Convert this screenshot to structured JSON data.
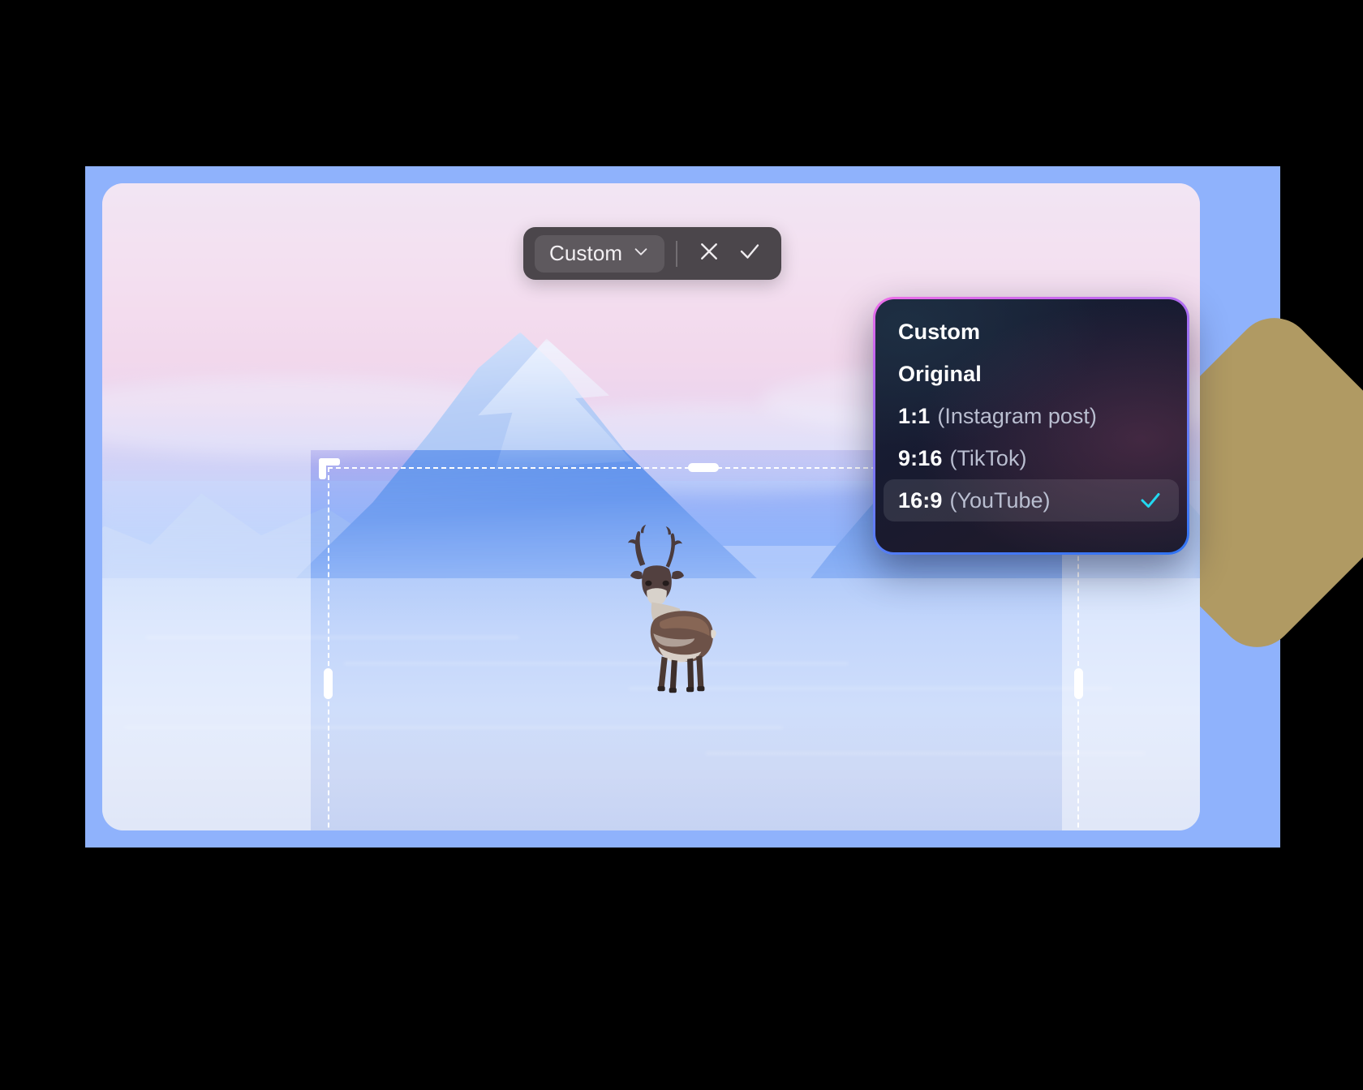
{
  "app": {
    "tool": "image-crop-editor"
  },
  "toolbar": {
    "ratio_label": "Custom",
    "chevron_icon": "chevron-down-icon",
    "cancel_icon": "close-icon",
    "confirm_icon": "check-icon"
  },
  "dropdown": {
    "items": [
      {
        "main": "Custom",
        "sub": "",
        "selected": false
      },
      {
        "main": "Original",
        "sub": "",
        "selected": false
      },
      {
        "main": "1:1",
        "sub": "(Instagram post)",
        "selected": false
      },
      {
        "main": "9:16",
        "sub": "(TikTok)",
        "selected": false
      },
      {
        "main": "16:9",
        "sub": "(YouTube)",
        "selected": true
      }
    ],
    "check_icon": "check-icon"
  },
  "crop": {
    "handles": [
      "handle-top-left",
      "handle-top-center",
      "handle-top-right",
      "handle-middle-left",
      "handle-middle-right",
      "handle-bottom-left",
      "handle-bottom-center",
      "handle-bottom-right"
    ]
  },
  "colors": {
    "frame": "#8fb2fc",
    "gold_shape": "#b09a63",
    "toolbar_bg": "#4b464b",
    "toolbar_btn": "#5e595e",
    "menu_border_top": "#ee6fe8",
    "menu_border_bottom": "#2f73f2",
    "accent_check": "#22d8f0",
    "handle": "#ffffff"
  },
  "photo": {
    "subject": "reindeer",
    "scene": "snowy-mountain-sunset"
  }
}
